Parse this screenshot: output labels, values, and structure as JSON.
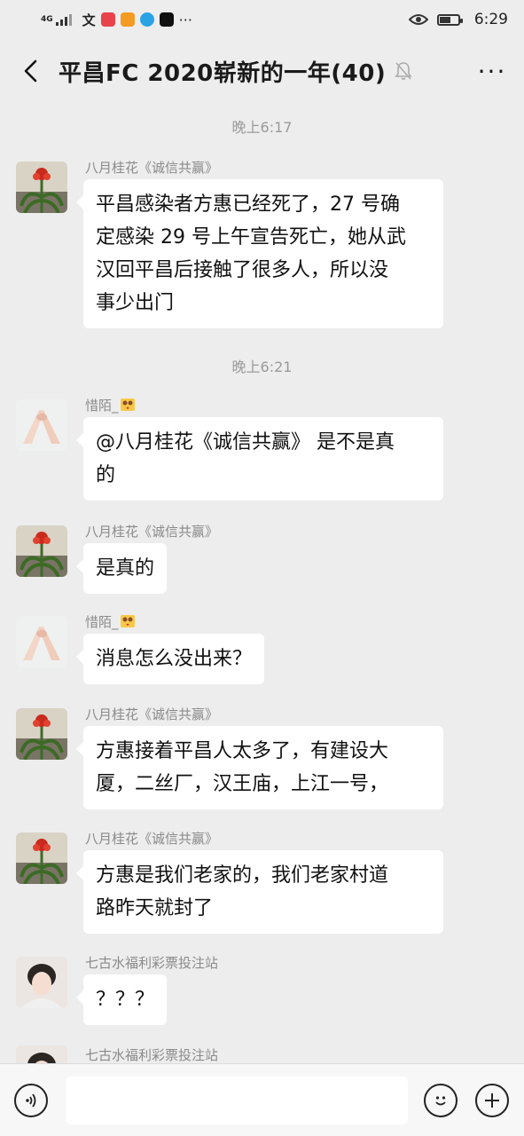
{
  "status_bar": {
    "network": "4G",
    "time": "6:29"
  },
  "header": {
    "title": "平昌FC  2020崭新的一年(40)",
    "back_icon": "chevron-left-icon",
    "mute_icon": "bell-muted-icon",
    "more_label": "···"
  },
  "timestamps": [
    "晚上6:17",
    "晚上6:21"
  ],
  "messages": [
    {
      "sender": "八月桂花《诚信共赢》",
      "avatar": "flower",
      "lines": [
        "平昌感染者方惠已经死了，27 号确",
        "定感染 29 号上午宣告死亡，她从武",
        "汉回平昌后接触了很多人，所以没",
        "事少出门"
      ]
    },
    {
      "sender": "惜陌_",
      "avatar": "hands",
      "lines": [
        "@八月桂花《诚信共赢》 是不是真",
        "的"
      ]
    },
    {
      "sender": "八月桂花《诚信共赢》",
      "avatar": "flower",
      "lines": [
        "是真的"
      ]
    },
    {
      "sender": "惜陌_",
      "avatar": "hands",
      "lines": [
        "消息怎么没出来？"
      ]
    },
    {
      "sender": "八月桂花《诚信共赢》",
      "avatar": "flower",
      "lines": [
        "方惠接着平昌人太多了，有建设大",
        "厦，二丝厂，汉王庙，上江一号，"
      ]
    },
    {
      "sender": "八月桂花《诚信共赢》",
      "avatar": "flower",
      "lines": [
        "方惠是我们老家的，我们老家村道",
        "路昨天就封了"
      ]
    },
    {
      "sender": "七古水福利彩票投注站",
      "avatar": "girl",
      "lines": [
        "？？？"
      ]
    },
    {
      "sender": "七古水福利彩票投注站",
      "avatar": "girl",
      "lines": []
    }
  ],
  "input_bar": {
    "placeholder": "",
    "voice_icon": "voice-icon",
    "emoji_icon": "emoji-icon",
    "plus_icon": "plus-icon"
  }
}
